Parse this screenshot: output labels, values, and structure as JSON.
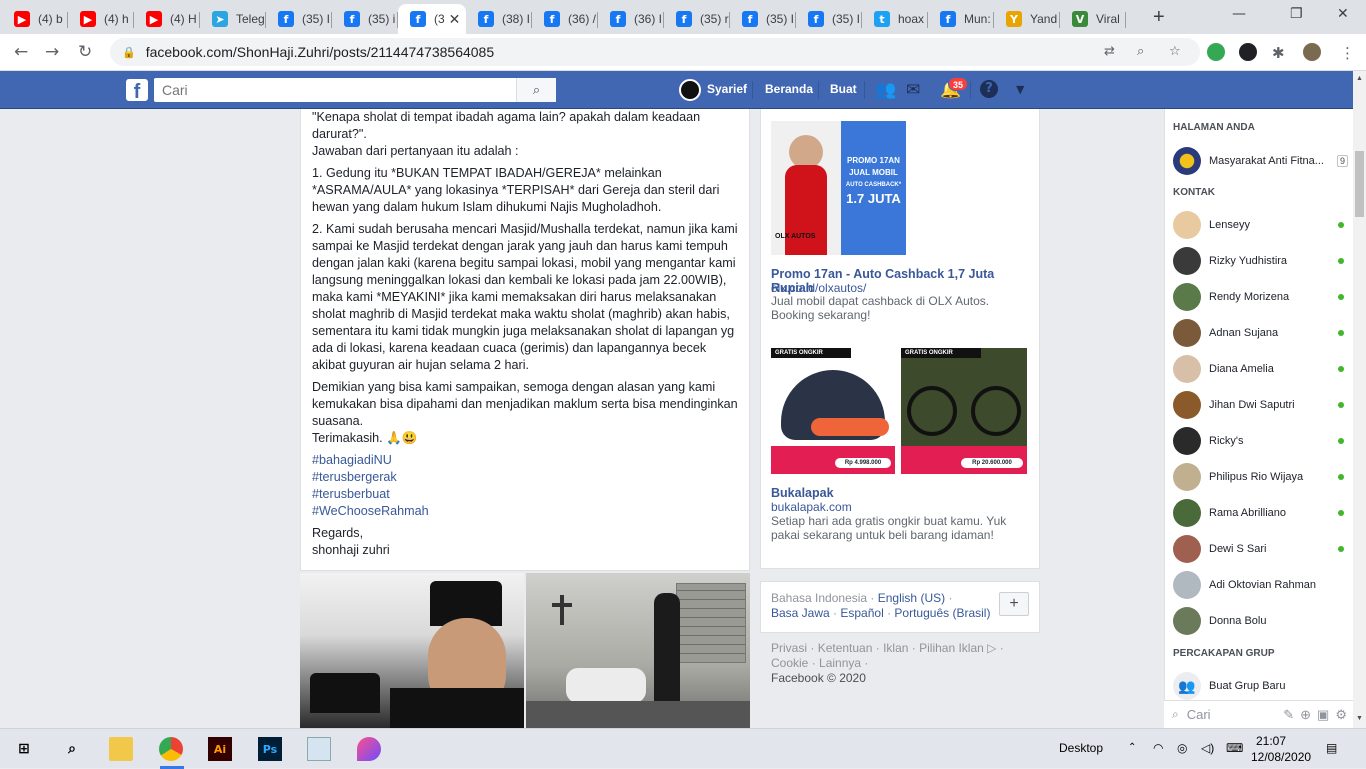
{
  "browser": {
    "tabs": [
      {
        "title": "(4) b",
        "icon": "youtube-icon",
        "color": "#ff0000"
      },
      {
        "title": "(4) h",
        "icon": "youtube-icon",
        "color": "#ff0000"
      },
      {
        "title": "(4) H",
        "icon": "youtube-icon",
        "color": "#ff0000"
      },
      {
        "title": "Teleg",
        "icon": "telegram-icon",
        "color": "#2ca5e0"
      },
      {
        "title": "(35) I",
        "icon": "facebook-icon",
        "color": "#1877f2"
      },
      {
        "title": "(35) i",
        "icon": "facebook-icon",
        "color": "#1877f2"
      },
      {
        "title": "(3",
        "icon": "facebook-icon",
        "color": "#1877f2",
        "active": true
      },
      {
        "title": "(38) I",
        "icon": "facebook-icon",
        "color": "#1877f2"
      },
      {
        "title": "(36) /",
        "icon": "facebook-icon",
        "color": "#1877f2"
      },
      {
        "title": "(36) I",
        "icon": "facebook-icon",
        "color": "#1877f2"
      },
      {
        "title": "(35) r",
        "icon": "facebook-icon",
        "color": "#1877f2"
      },
      {
        "title": "(35) I",
        "icon": "facebook-icon",
        "color": "#1877f2"
      },
      {
        "title": "(35) I",
        "icon": "facebook-icon",
        "color": "#1877f2"
      },
      {
        "title": "hoax",
        "icon": "twitter-icon",
        "color": "#1da1f2"
      },
      {
        "title": "Mun:",
        "icon": "facebook-icon",
        "color": "#1877f2"
      },
      {
        "title": "Yand",
        "icon": "yandex-icon",
        "color": "#e8a400"
      },
      {
        "title": "Viral",
        "icon": "viral-icon",
        "color": "#3a8a3a"
      }
    ],
    "url": "facebook.com/ShonHaji.Zuhri/posts/2114474738564085"
  },
  "fb": {
    "search_placeholder": "Cari",
    "user_name": "Syarief",
    "nav_home": "Beranda",
    "nav_create": "Buat",
    "notif_count": "35"
  },
  "post": {
    "paragraphs": [
      "\"Kenapa sholat di tempat ibadah agama lain? apakah dalam keadaan darurat?\".\nJawaban dari pertanyaan itu adalah :",
      "1. Gedung itu *BUKAN TEMPAT IBADAH/GEREJA* melainkan *ASRAMA/AULA* yang lokasinya *TERPISAH* dari Gereja dan steril dari hewan yang dalam hukum Islam dihukumi Najis Mugholadhoh.",
      "2. Kami sudah berusaha mencari Masjid/Mushalla terdekat, namun jika kami sampai ke Masjid terdekat dengan jarak yang jauh dan harus kami tempuh dengan jalan kaki (karena begitu sampai lokasi, mobil yang mengantar kami langsung meninggalkan lokasi dan kembali ke lokasi pada jam 22.00WIB), maka kami *MEYAKINI* jika kami memaksakan diri harus melaksanakan sholat maghrib di Masjid terdekat maka waktu sholat (maghrib) akan habis, sementara itu kami tidak mungkin juga melaksanakan sholat di lapangan yg ada di lokasi, karena keadaan cuaca (gerimis) dan lapangannya becek akibat guyuran air hujan selama 2 hari.",
      "Demikian yang bisa kami sampaikan, semoga dengan alasan yang kami kemukakan bisa dipahami dan menjadikan maklum serta bisa mendinginkan suasana.\nTerimakasih. 🙏😃"
    ],
    "hashtags": [
      "#bahagiadiNU",
      "#terusbergerak",
      "#terusberbuat",
      "#WeChooseRahmah"
    ],
    "signoff": "Regards,\nshonhaji zuhri"
  },
  "ads": [
    {
      "title": "Promo 17an - Auto Cashback 1,7 Juta Rupiah",
      "url": "olx.co.id/olxautos/",
      "desc": "Jual mobil dapat cashback di OLX Autos. Booking sekarang!",
      "banner_lines": [
        "PROMO 17AN",
        "JUAL MOBIL",
        "AUTO CASHBACK*",
        "1.7 JUTA"
      ],
      "brand": "OLX AUTOS"
    },
    {
      "title": "Bukalapak",
      "url": "bukalapak.com",
      "desc": "Setiap hari ada gratis ongkir buat kamu. Yuk pakai sekarang untuk beli barang idaman!",
      "ribbon": "GRATIS ONGKIR",
      "price1": "Rp 4.998.000",
      "price2": "Rp 20.600.000"
    }
  ],
  "languages": {
    "current": "Bahasa Indonesia",
    "others": [
      "English (US)",
      "Basa Jawa",
      "Español",
      "Português (Brasil)"
    ],
    "plus": "+"
  },
  "footer": {
    "links": [
      "Privasi",
      "Ketentuan",
      "Iklan",
      "Pilihan Iklan ▷",
      "Cookie",
      "Lainnya"
    ],
    "copyright": "Facebook © 2020"
  },
  "chat": {
    "pages_header": "HALAMAN ANDA",
    "page_name": "Masyarakat Anti Fitna...",
    "page_badge": "9",
    "contacts_header": "KONTAK",
    "contacts": [
      {
        "name": "Lenseyy",
        "online": true
      },
      {
        "name": "Rizky Yudhistira",
        "online": true
      },
      {
        "name": "Rendy Morizena",
        "online": true
      },
      {
        "name": "Adnan Sujana",
        "online": true
      },
      {
        "name": "Diana Amelia",
        "online": true
      },
      {
        "name": "Jihan Dwi Saputri",
        "online": true
      },
      {
        "name": "Ricky's",
        "online": true
      },
      {
        "name": "Philipus Rio Wijaya",
        "online": true
      },
      {
        "name": "Rama Abrilliano",
        "online": true
      },
      {
        "name": "Dewi S Sari",
        "online": true
      },
      {
        "name": "Adi Oktovian Rahman",
        "online": false
      },
      {
        "name": "Donna Bolu",
        "online": false
      }
    ],
    "groups_header": "PERCAKAPAN GRUP",
    "new_group": "Buat Grup Baru",
    "search_placeholder": "Cari"
  },
  "taskbar": {
    "desktop_label": "Desktop",
    "time": "21:07",
    "date": "12/08/2020"
  },
  "colors": {
    "fb_blue": "#4267b2",
    "link": "#385898",
    "online": "#42b72a"
  }
}
